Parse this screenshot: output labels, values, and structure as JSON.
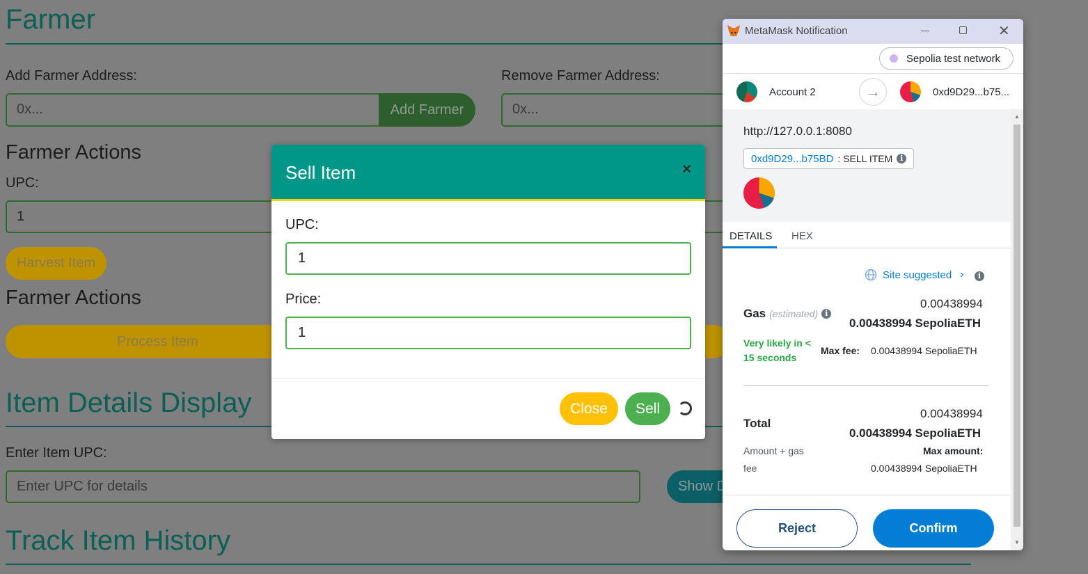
{
  "page": {
    "farmer_heading": "Farmer",
    "add_farmer_label": "Add Farmer Address:",
    "add_farmer_placeholder": "0x...",
    "add_farmer_button": "Add Farmer",
    "remove_farmer_label": "Remove Farmer Address:",
    "remove_farmer_placeholder": "0x...",
    "farmer_actions_1": "Farmer Actions",
    "upc_label": "UPC:",
    "upc_value": "1",
    "harvest_button": "Harvest Item",
    "farmer_actions_2": "Farmer Actions",
    "process_button": "Process Item",
    "item_details_heading": "Item Details Display",
    "enter_upc_label": "Enter Item UPC:",
    "enter_upc_placeholder": "Enter UPC for details",
    "show_details_button": "Show D",
    "track_history_heading": "Track Item History"
  },
  "modal": {
    "title": "Sell Item",
    "close_icon": "×",
    "upc_label": "UPC:",
    "upc_value": "1",
    "price_label": "Price:",
    "price_value": "1",
    "close_button": "Close",
    "sell_button": "Sell"
  },
  "metamask": {
    "window_title": "MetaMask Notification",
    "network": "Sepolia test network",
    "account_from": "Account 2",
    "account_to": "0xd9D29...b75...",
    "origin": "http://127.0.0.1:8080",
    "contract_address": "0xd9D29...b75BD",
    "method": ": SELL ITEM",
    "tabs": [
      "DETAILS",
      "HEX"
    ],
    "site_suggested": "Site suggested",
    "gas_label": "Gas",
    "gas_estimated": "(estimated)",
    "gas_value": "0.00438994",
    "gas_value_eth": "0.00438994 SepoliaETH",
    "likely_line1": "Very likely in <",
    "likely_line2": "15 seconds",
    "max_fee_label": "Max fee:",
    "max_fee_value": "0.00438994 SepoliaETH",
    "total_label": "Total",
    "total_value": "0.00438994",
    "total_value_eth": "0.00438994 SepoliaETH",
    "amount_gas_line1": "Amount + gas",
    "amount_gas_line2": "fee",
    "max_amount_label": "Max amount:",
    "max_amount_value": "0.00438994 SepoliaETH",
    "reject_button": "Reject",
    "confirm_button": "Confirm"
  },
  "colors": {
    "teal": "#009688",
    "accent_yellow": "#ffc107",
    "green": "#4caf50",
    "metamask_blue": "#037dd6",
    "success_green": "#28a745"
  },
  "icons": [
    "close-icon",
    "metamask-fox-icon",
    "minimize-icon",
    "maximize-icon",
    "window-close-icon",
    "arrow-right-icon",
    "globe-icon",
    "chevron-right-icon",
    "info-icon",
    "spinner-icon"
  ]
}
